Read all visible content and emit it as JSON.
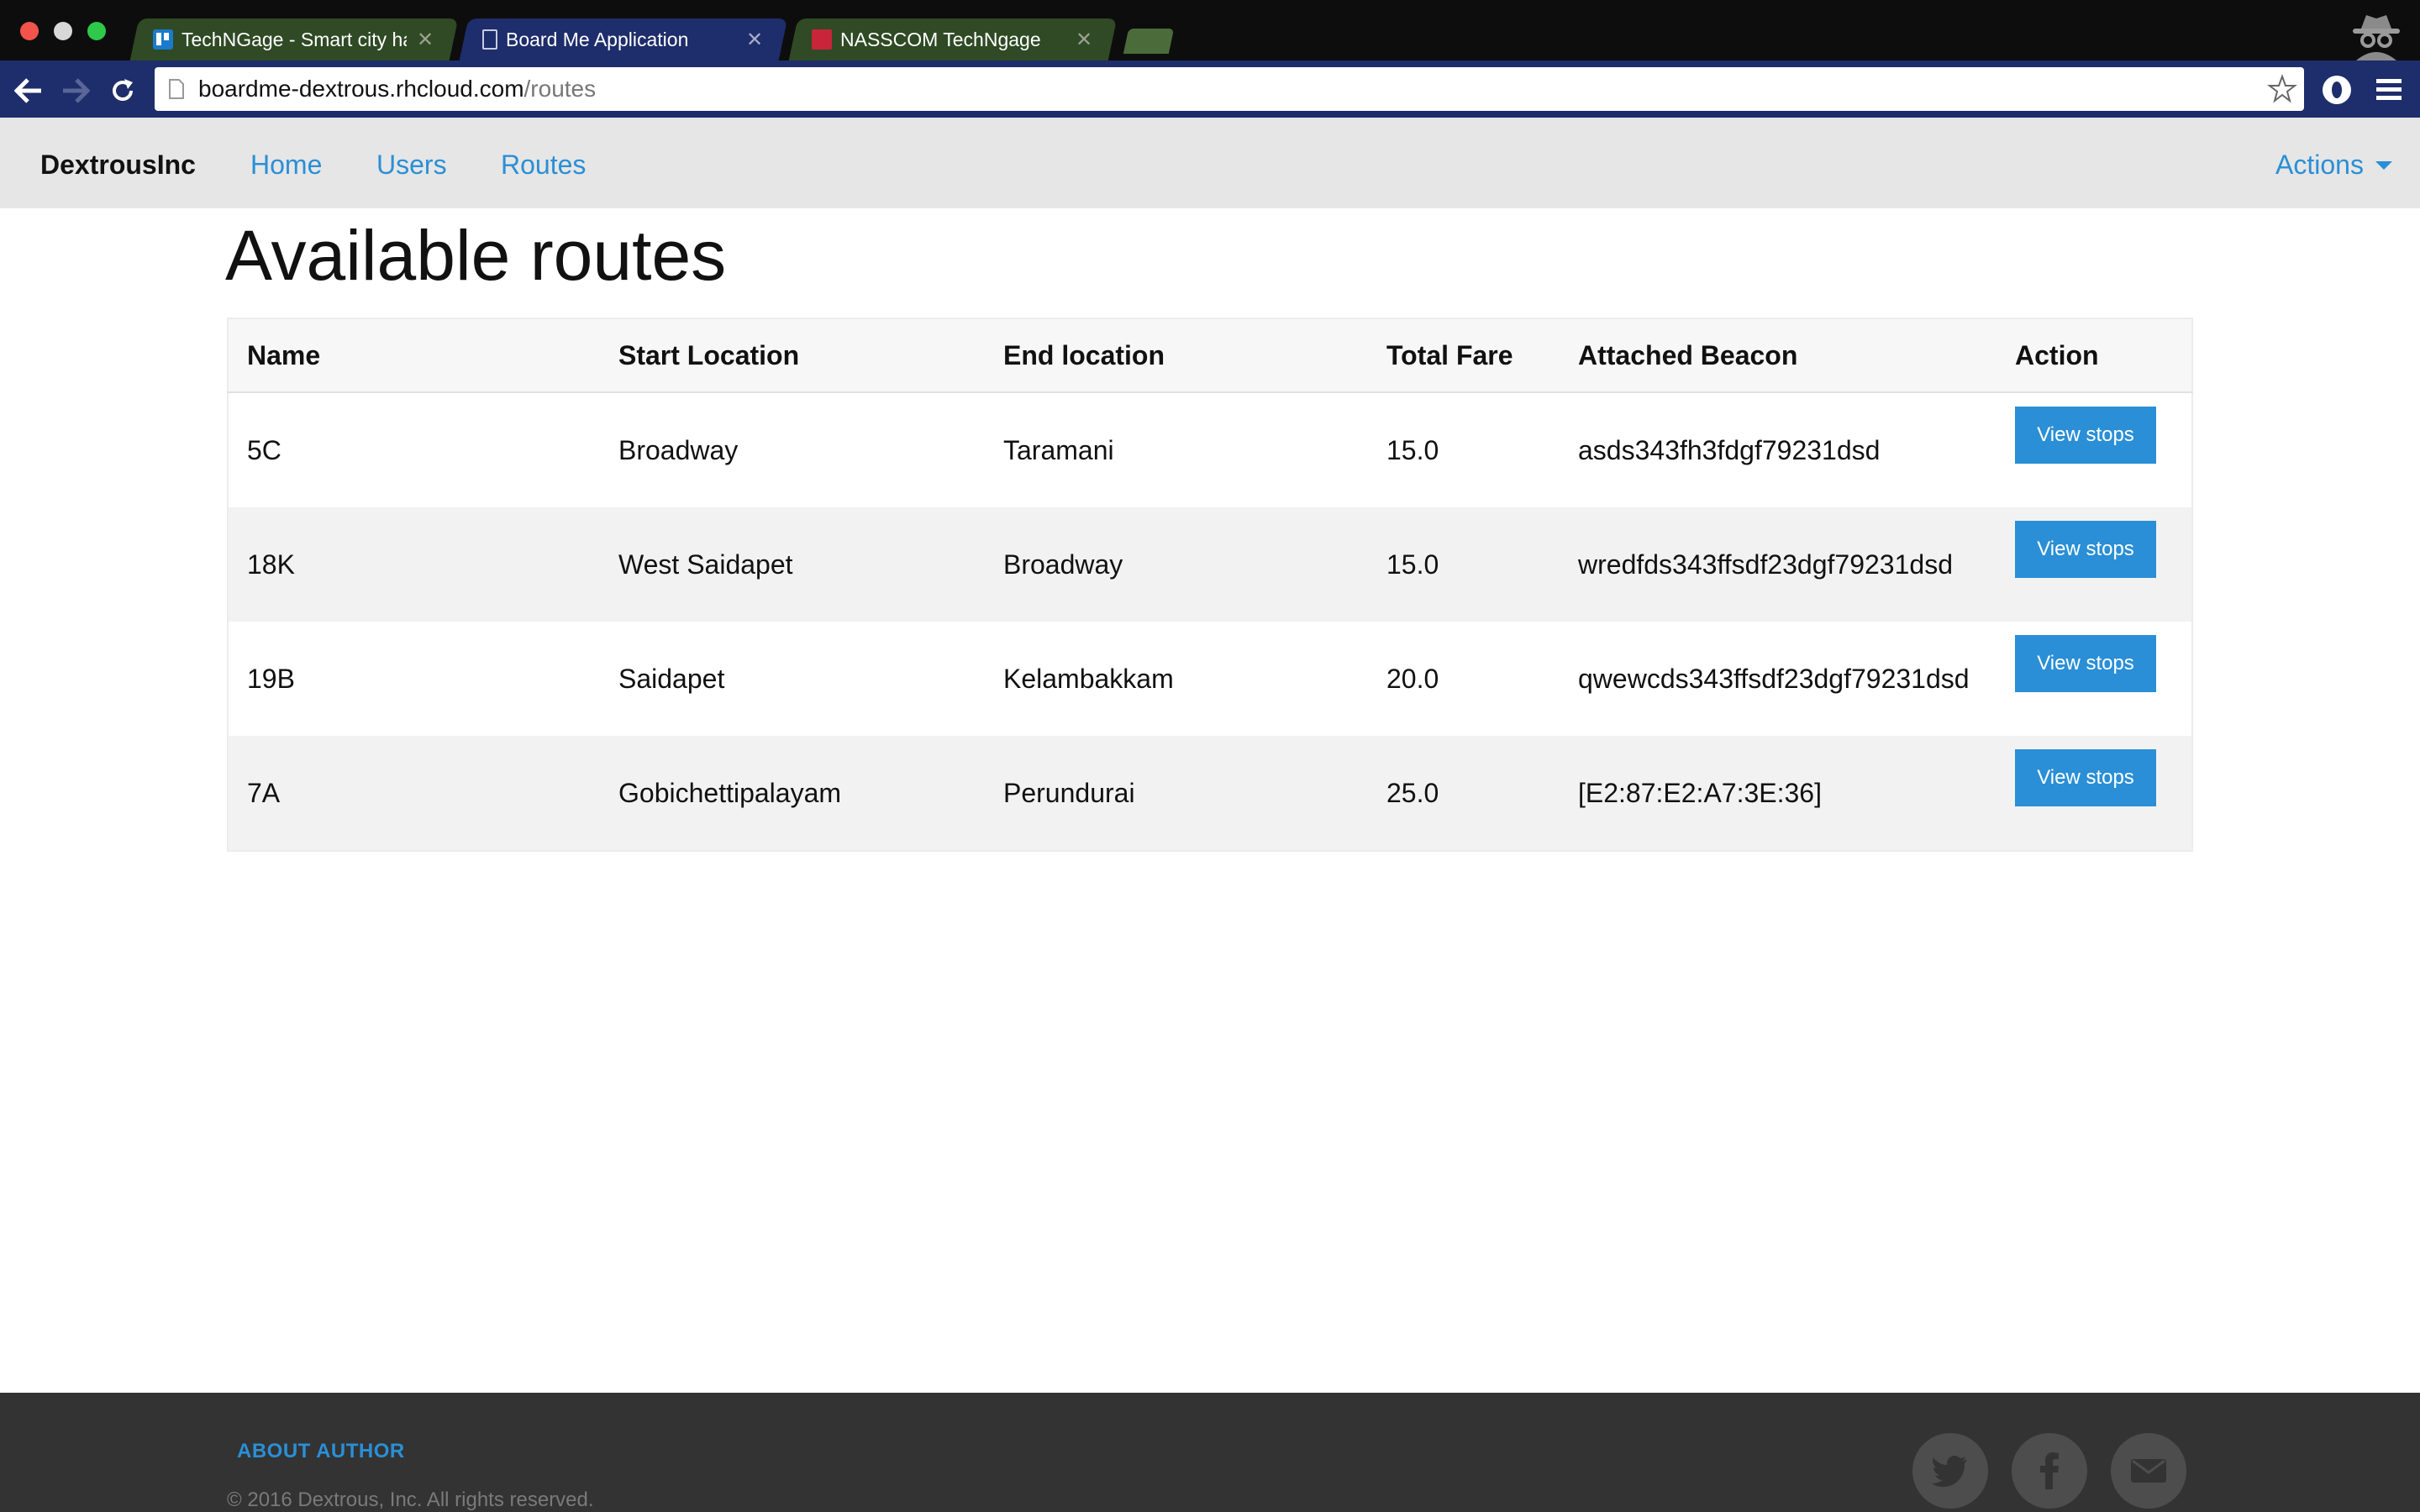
{
  "browser": {
    "tabs": [
      {
        "title": "TechNGage - Smart city ha",
        "favicon": "trello-icon",
        "active": false
      },
      {
        "title": "Board Me Application",
        "favicon": "document-icon",
        "active": true
      },
      {
        "title": "NASSCOM TechNgage",
        "favicon": "nasscom-icon",
        "active": false
      }
    ],
    "tab_close_glyph": "✕",
    "url": {
      "host": "boardme-dextrous.rhcloud.com",
      "path": "/routes"
    }
  },
  "navbar": {
    "brand": "DextrousInc",
    "links": [
      "Home",
      "Users",
      "Routes"
    ],
    "actions_label": "Actions"
  },
  "page": {
    "title": "Available routes"
  },
  "table": {
    "headers": [
      "Name",
      "Start Location",
      "End location",
      "Total Fare",
      "Attached Beacon",
      "Action"
    ],
    "rows": [
      {
        "name": "5C",
        "start": "Broadway",
        "end": "Taramani",
        "fare": "15.0",
        "beacon": "asds343fh3fdgf79231dsd",
        "action": "View stops"
      },
      {
        "name": "18K",
        "start": "West Saidapet",
        "end": "Broadway",
        "fare": "15.0",
        "beacon": "wredfds343ffsdf23dgf79231dsd",
        "action": "View stops"
      },
      {
        "name": "19B",
        "start": "Saidapet",
        "end": "Kelambakkam",
        "fare": "20.0",
        "beacon": "qwewcds343ffsdf23dgf79231dsd",
        "action": "View stops"
      },
      {
        "name": "7A",
        "start": "Gobichettipalayam",
        "end": "Perundurai",
        "fare": "25.0",
        "beacon": "[E2:87:E2:A7:3E:36]",
        "action": "View stops"
      }
    ]
  },
  "footer": {
    "heading": "ABOUT AUTHOR",
    "copyright": "© 2016 Dextrous, Inc. All rights reserved.",
    "social": [
      "twitter-icon",
      "facebook-icon",
      "email-icon"
    ]
  },
  "colors": {
    "accent": "#2a8fd6",
    "navbar_bg": "#e6e6e6",
    "footer_bg": "#333333",
    "browser_toolbar": "#1e2d6b"
  }
}
